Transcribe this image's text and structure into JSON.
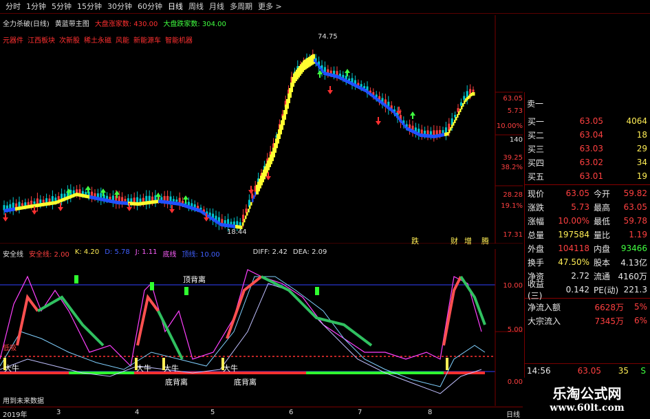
{
  "toolbar": {
    "items": [
      "分时",
      "1分钟",
      "5分钟",
      "15分钟",
      "30分钟",
      "60分钟",
      "日线",
      "周线",
      "月线",
      "多周期",
      "更多 >"
    ]
  },
  "main_title": {
    "name": "全力杀破(日线)",
    "indicator": "黄蓝带主图",
    "up_label": "大盘涨家数: 430.00",
    "down_label": "大盘跌家数: 304.00"
  },
  "concepts": [
    "元器件",
    "江西板块",
    "次新股",
    "稀土永磁",
    "风能",
    "新能源车",
    "智能机器"
  ],
  "price_axis": [
    "63.05",
    "5.73",
    "10.00%",
    "140",
    "39.25",
    "38.2%",
    "28.28",
    "19.1%",
    "17.31"
  ],
  "price_marks": {
    "high": "74.75",
    "low": "18.44"
  },
  "chart_markers": [
    "跌",
    "财",
    "增",
    "腾"
  ],
  "sub_header": {
    "name": "安全线",
    "safe": "安全线: 2.00",
    "k": "K: 4.20",
    "d": "D: 5.78",
    "j": "J: 1.11",
    "bottom": "底线",
    "top": "顶线: 10.00",
    "diff": "DIFF: 2.42",
    "dea": "DEA: 2.09"
  },
  "sub_axis": [
    "10.00",
    "5.00",
    "0.00"
  ],
  "sub_annotations": {
    "top_div": "顶背离",
    "bottom_div_1": "底背离",
    "bottom_div_2": "底背离",
    "bull": "大牛",
    "low_label": "低吸",
    "future": "用到未来数据"
  },
  "date_axis": [
    "2019年",
    "3",
    "4",
    "5",
    "6",
    "7",
    "8",
    "日线"
  ],
  "order_book": {
    "sell_one": "卖一",
    "bids": [
      {
        "label": "买一",
        "price": "63.05",
        "vol": "4064"
      },
      {
        "label": "买二",
        "price": "63.04",
        "vol": "18"
      },
      {
        "label": "买三",
        "price": "63.03",
        "vol": "29"
      },
      {
        "label": "买四",
        "price": "63.02",
        "vol": "34"
      },
      {
        "label": "买五",
        "price": "63.01",
        "vol": "19"
      }
    ]
  },
  "stats": [
    {
      "l1": "现价",
      "v1": "63.05",
      "c1": "red",
      "l2": "今开",
      "v2": "59.82",
      "c2": "red"
    },
    {
      "l1": "涨跌",
      "v1": "5.73",
      "c1": "red",
      "l2": "最高",
      "v2": "63.05",
      "c2": "red"
    },
    {
      "l1": "涨幅",
      "v1": "10.00%",
      "c1": "red",
      "l2": "最低",
      "v2": "59.78",
      "c2": "red"
    },
    {
      "l1": "总量",
      "v1": "197584",
      "c1": "yel",
      "l2": "量比",
      "v2": "1.19",
      "c2": "red"
    },
    {
      "l1": "外盘",
      "v1": "104118",
      "c1": "red",
      "l2": "内盘",
      "v2": "93466",
      "c2": "grn"
    },
    {
      "l1": "换手",
      "v1": "47.50%",
      "c1": "yel",
      "l2": "股本",
      "v2": "4.13亿",
      "c2": "wht"
    },
    {
      "l1": "净资",
      "v1": "2.72",
      "c1": "wht",
      "l2": "流通",
      "v2": "4160万",
      "c2": "wht"
    },
    {
      "l1": "收益(三)",
      "v1": "0.142",
      "c1": "wht",
      "l2": "PE(动)",
      "v2": "221.3",
      "c2": "wht"
    }
  ],
  "flows": [
    {
      "label": "净流入额",
      "value": "6628万",
      "pct": "5%"
    },
    {
      "label": "大宗流入",
      "value": "7345万",
      "pct": "6%"
    }
  ],
  "time_row": {
    "time": "14:56",
    "price": "63.05",
    "vol": "35",
    "side": "S"
  },
  "watermark": {
    "line1": "乐淘公式网",
    "line2": "www.60lt.com"
  },
  "colors": {
    "up": "#ff4040",
    "down": "#00d0d0",
    "yellow_band": "#ffff30",
    "blue_band": "#2050ff",
    "grid": "#7a0000"
  }
}
